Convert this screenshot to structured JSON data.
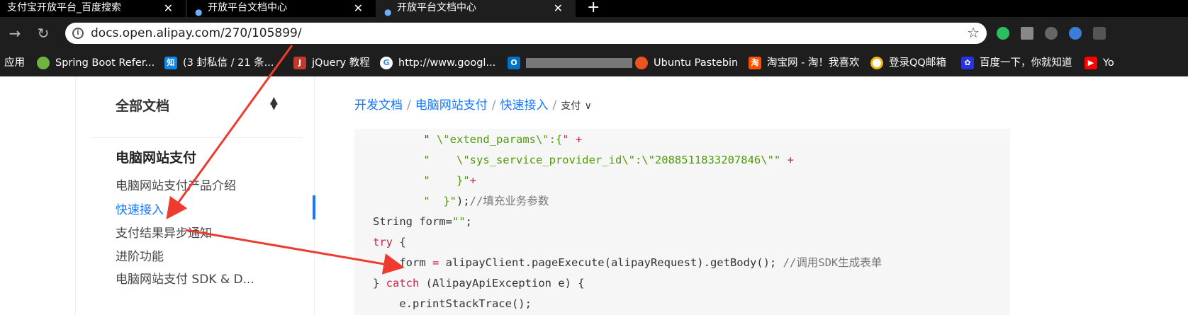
{
  "tabs": [
    {
      "title": "支付宝开放平台_百度搜索",
      "close": "✕"
    },
    {
      "title": "开放平台文档中心",
      "close": "✕"
    },
    {
      "title": "开放平台文档中心",
      "close": "✕"
    }
  ],
  "new_tab": "+",
  "toolbar": {
    "back": "←",
    "forward": "→",
    "reload": "↻",
    "url": "docs.open.alipay.com/270/105899/",
    "info": "i",
    "bookmark_star": "☆"
  },
  "bookmarks": [
    {
      "label": "应用",
      "icon": ""
    },
    {
      "label": "Spring Boot Refer...",
      "icon": "spring-icon"
    },
    {
      "label": "(3 封私信 / 21 条...",
      "icon": "zhihu-icon"
    },
    {
      "label": "jQuery 教程",
      "icon": "runoob-icon"
    },
    {
      "label": "http://www.googl...",
      "icon": "google-icon"
    },
    {
      "label": "",
      "icon": "outlook-icon"
    },
    {
      "label": "Ubuntu Pastebin",
      "icon": "ubuntu-icon"
    },
    {
      "label": "淘宝网 - 淘！我喜欢",
      "icon": "taobao-icon"
    },
    {
      "label": "登录QQ邮箱",
      "icon": "qqmail-icon"
    },
    {
      "label": "百度一下，你就知道",
      "icon": "baidu-icon"
    },
    {
      "label": "Yo",
      "icon": "youtube-icon"
    }
  ],
  "sidebar": {
    "all_docs": "全部文档",
    "toggle": "⬍",
    "section": "电脑网站支付",
    "items": [
      {
        "label": "电脑网站支付产品介绍"
      },
      {
        "label": "快速接入",
        "active": true
      },
      {
        "label": "支付结果异步通知"
      },
      {
        "label": "进阶功能"
      },
      {
        "label": "电脑网站支付 SDK & D..."
      }
    ]
  },
  "breadcrumb": {
    "items": [
      "开发文档",
      "电脑网站支付",
      "快速接入"
    ],
    "current": "支付",
    "chevron": "∨"
  },
  "code_lines": [
    {
      "tokens": [
        {
          "c": "p",
          "t": "    \" "
        },
        {
          "c": "s",
          "t": "\\\"extend_params\\\":{"
        },
        {
          "c": "k",
          "t": "\" +"
        }
      ]
    },
    {
      "tokens": [
        {
          "c": "s",
          "t": "    \"    \\\"sys_service_provider_id\\\":\\\"2088511833207846\\\"\""
        },
        {
          "c": "k",
          "t": " +"
        }
      ]
    },
    {
      "tokens": [
        {
          "c": "s",
          "t": "    \"    }\""
        },
        {
          "c": "k",
          "t": "+"
        }
      ]
    },
    {
      "tokens": [
        {
          "c": "s",
          "t": "    \"  }\""
        },
        {
          "c": "p",
          "t": ");"
        },
        {
          "c": "c",
          "t": "//填充业务参数"
        }
      ]
    },
    {
      "tokens": [
        {
          "c": "p",
          "t": "String form="
        },
        {
          "c": "s",
          "t": "\"\""
        },
        {
          "c": "p",
          "t": ";"
        }
      ]
    },
    {
      "tokens": [
        {
          "c": "k",
          "t": "try"
        },
        {
          "c": "p",
          "t": " {"
        }
      ]
    },
    {
      "tokens": [
        {
          "c": "p",
          "t": "    form "
        },
        {
          "c": "k",
          "t": "="
        },
        {
          "c": "p",
          "t": " alipayClient.pageExecute(alipayRequest).getBody(); "
        },
        {
          "c": "c",
          "t": "//调用SDK生成表单"
        }
      ]
    },
    {
      "tokens": [
        {
          "c": "p",
          "t": "} "
        },
        {
          "c": "k",
          "t": "catch"
        },
        {
          "c": "p",
          "t": " (AlipayApiException e) {"
        }
      ]
    },
    {
      "tokens": [
        {
          "c": "p",
          "t": "    e.printStackTrace();"
        }
      ]
    }
  ],
  "colors": {
    "accent": "#1677ff",
    "arrow": "#ee3b2f",
    "browser_chrome": "#1e1e1e"
  }
}
